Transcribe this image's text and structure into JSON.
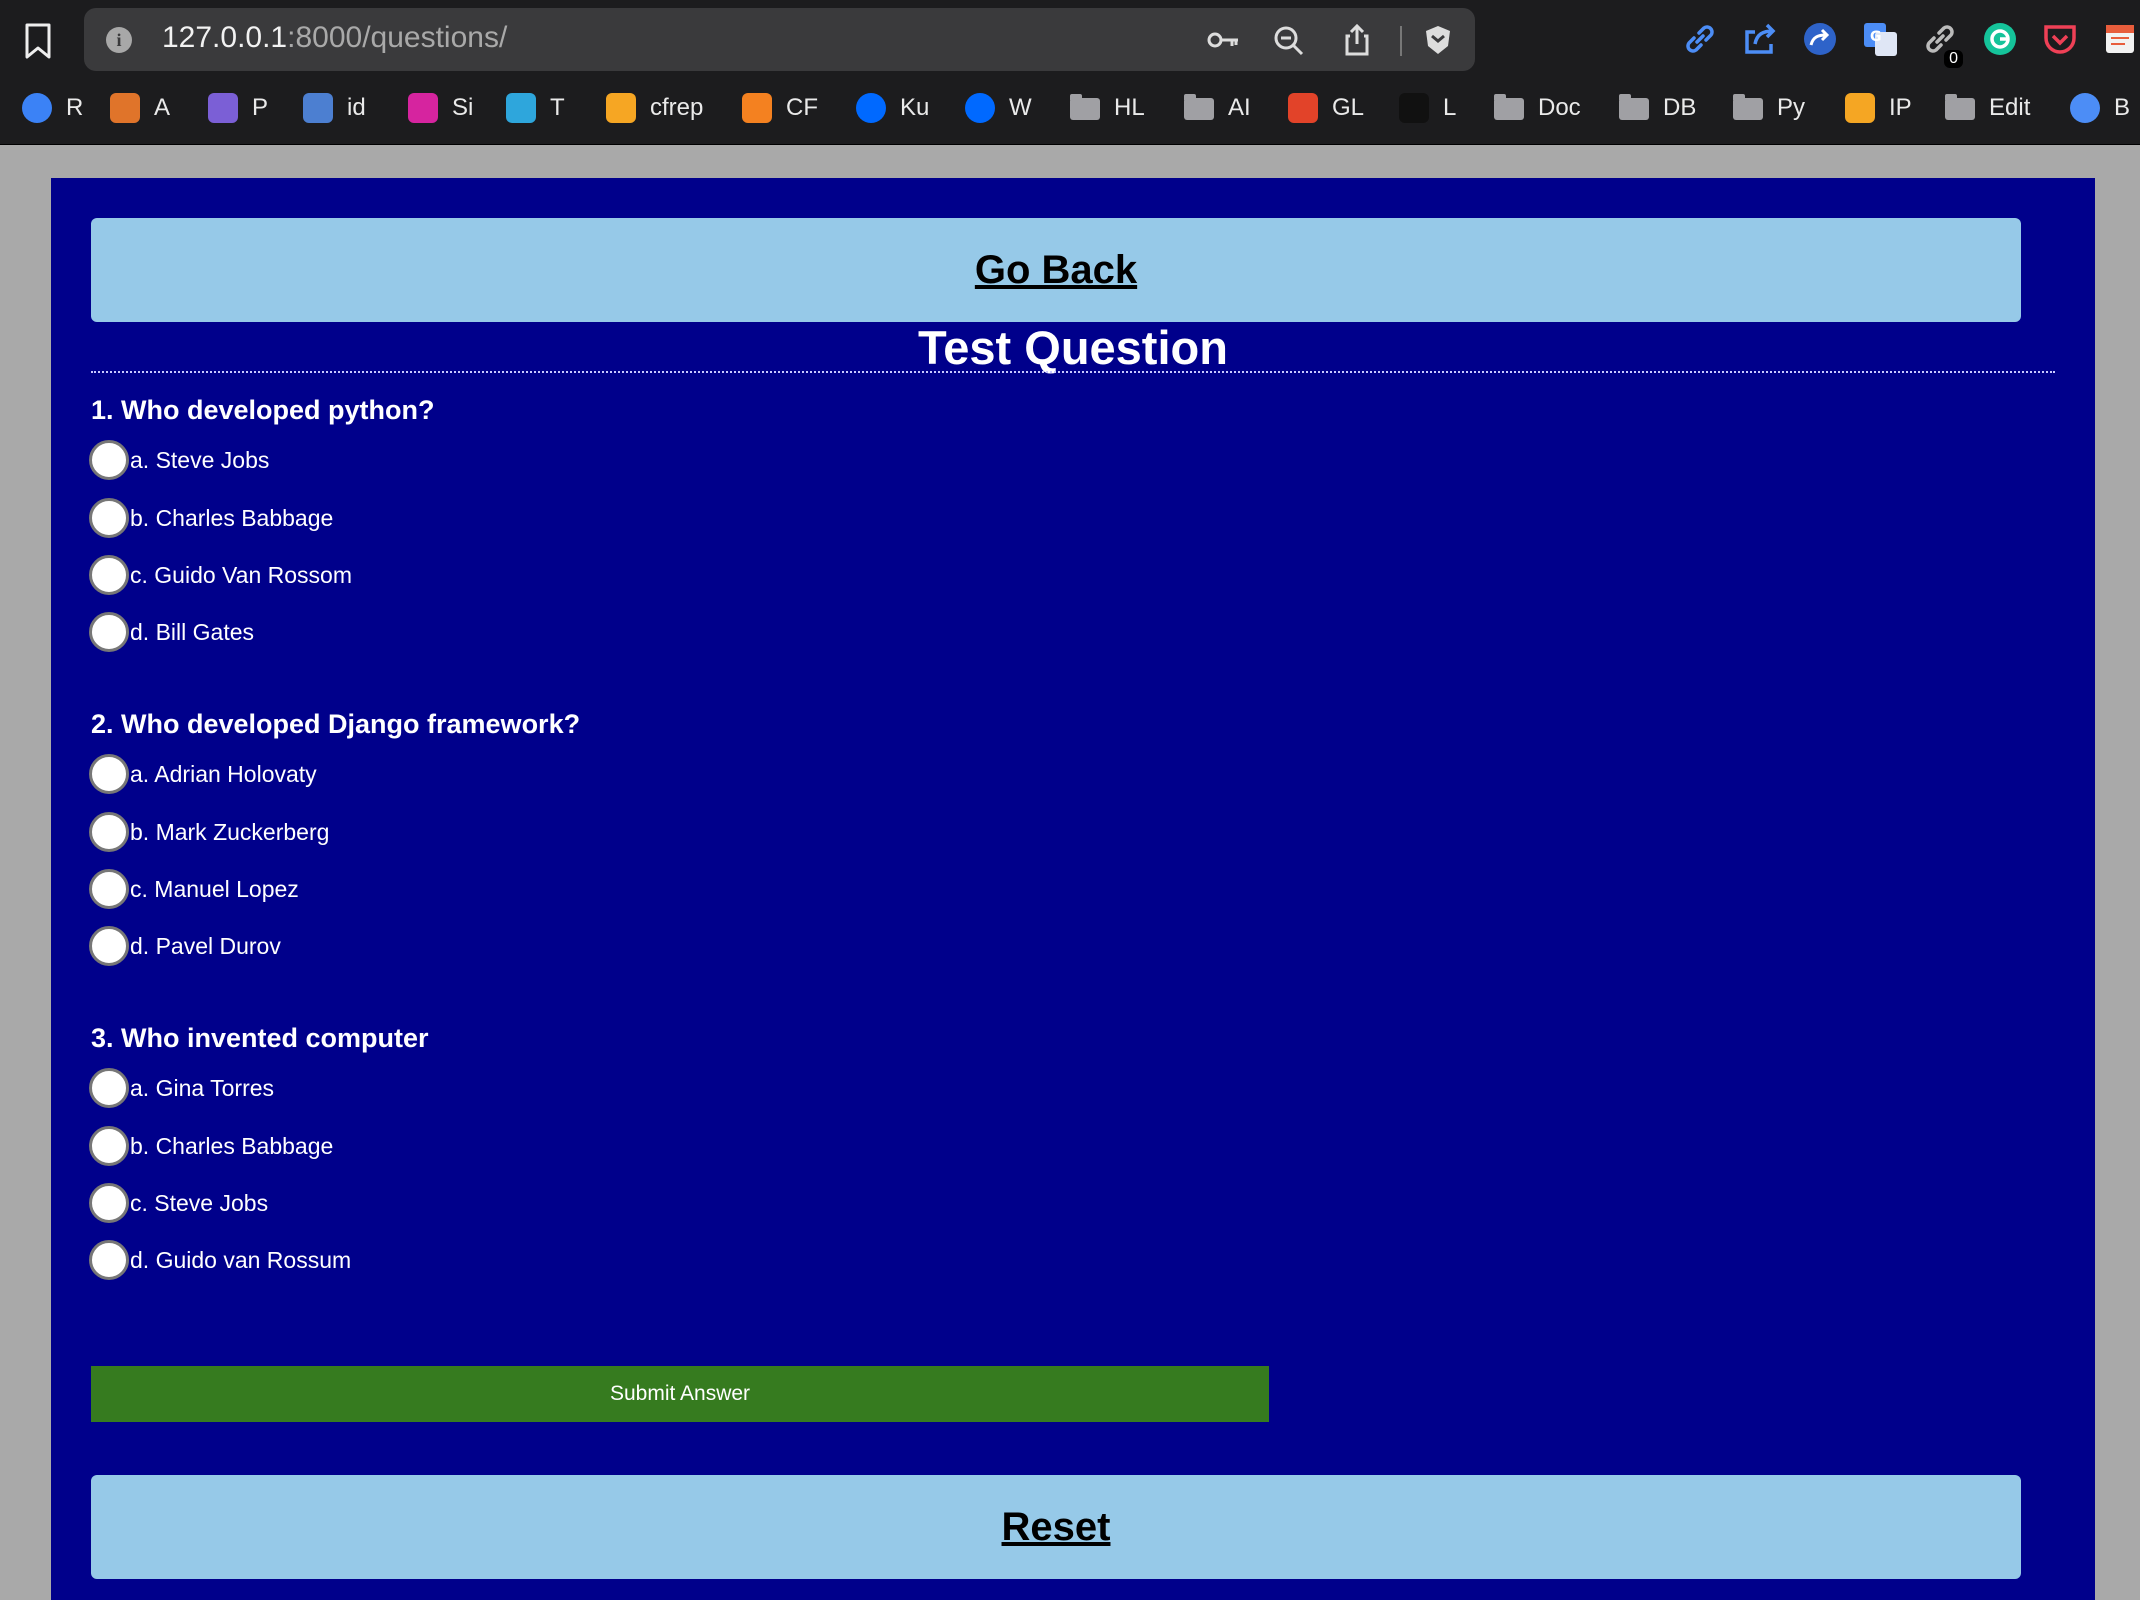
{
  "browser": {
    "url_host": "127.0.0.1",
    "url_path": ":8000/questions/",
    "extension_badge": "0",
    "bookmarks": [
      {
        "label": "R",
        "icon": "linear-icon",
        "color": "#3b82f6"
      },
      {
        "label": "A",
        "icon": "app-icon",
        "color": "#e0742a"
      },
      {
        "label": "P",
        "icon": "list-icon",
        "color": "#7b5fd6"
      },
      {
        "label": "id",
        "icon": "calendar-icon",
        "color": "#4c7fd1"
      },
      {
        "label": "Si",
        "icon": "instagram-icon",
        "color": "#d6249f"
      },
      {
        "label": "T",
        "icon": "telegram-icon",
        "color": "#2ea6dc"
      },
      {
        "label": "cfrep",
        "icon": "firebase-icon",
        "color": "#f6a623"
      },
      {
        "label": "CF",
        "icon": "cloudflare-icon",
        "color": "#f48120"
      },
      {
        "label": "Ku",
        "icon": "digitalocean-icon",
        "color": "#0069ff"
      },
      {
        "label": "W",
        "icon": "digitalocean-icon",
        "color": "#0069ff"
      },
      {
        "label": "HL",
        "icon": "folder-icon",
        "color": "#a0a0a4"
      },
      {
        "label": "AI",
        "icon": "folder-icon",
        "color": "#a0a0a4"
      },
      {
        "label": "GL",
        "icon": "gitlab-icon",
        "color": "#e24329"
      },
      {
        "label": "L",
        "icon": "swirl-icon",
        "color": "#111111"
      },
      {
        "label": "Doc",
        "icon": "folder-icon",
        "color": "#a0a0a4"
      },
      {
        "label": "DB",
        "icon": "folder-icon",
        "color": "#a0a0a4"
      },
      {
        "label": "Py",
        "icon": "folder-icon",
        "color": "#a0a0a4"
      },
      {
        "label": "IP",
        "icon": "cube-icon",
        "color": "#f5a623"
      },
      {
        "label": "Edit",
        "icon": "folder-icon",
        "color": "#a0a0a4"
      },
      {
        "label": "B",
        "icon": "sparkle-icon",
        "color": "#4c8df6"
      }
    ]
  },
  "page": {
    "go_back_label": "Go Back",
    "title": "Test Question",
    "submit_label": "Submit Answer",
    "reset_label": "Reset",
    "background_color": "#00008b",
    "nav_button_color": "#96c9e8",
    "submit_color": "#367b1f"
  },
  "questions": [
    {
      "text": "1. Who developed python?",
      "options": [
        "a. Steve Jobs",
        "b. Charles Babbage",
        "c. Guido Van Rossom",
        "d. Bill Gates"
      ]
    },
    {
      "text": "2. Who developed Django framework?",
      "options": [
        "a. Adrian Holovaty",
        "b. Mark Zuckerberg",
        "c. Manuel Lopez",
        "d. Pavel Durov"
      ]
    },
    {
      "text": "3. Who invented computer",
      "options": [
        "a. Gina Torres",
        "b. Charles Babbage",
        "c. Steve Jobs",
        "d. Guido van Rossum"
      ]
    }
  ]
}
